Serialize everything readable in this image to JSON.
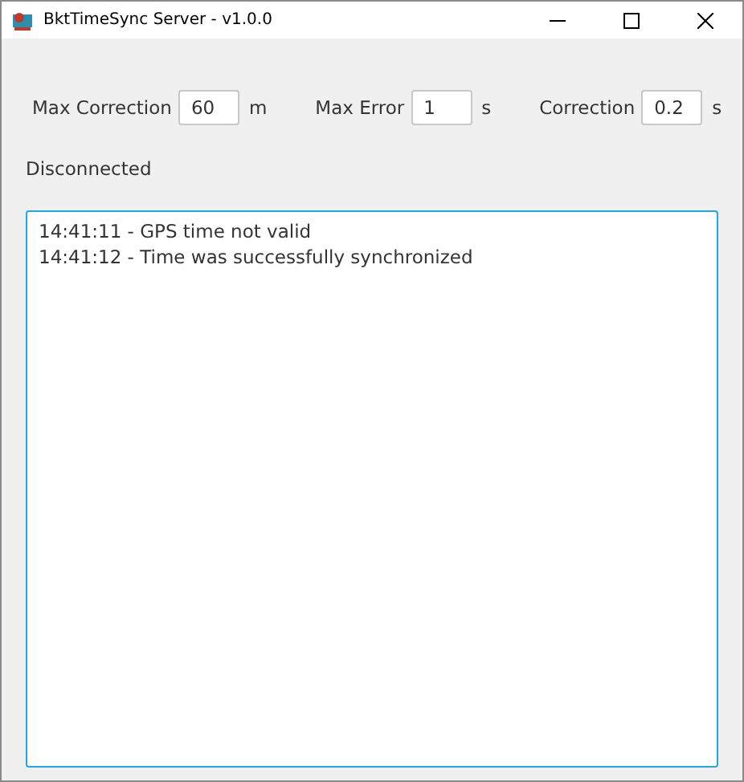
{
  "window": {
    "title": "BktTimeSync Server - v1.0.0"
  },
  "settings": [
    {
      "label": "Max Correction",
      "value": "60",
      "unit": "m"
    },
    {
      "label": "Max Error",
      "value": "1",
      "unit": "s"
    },
    {
      "label": "Correction",
      "value": "0.2",
      "unit": "s"
    }
  ],
  "status": "Disconnected",
  "log": [
    "14:41:11 - GPS time not valid",
    "14:41:12 - Time was successfully synchronized"
  ]
}
